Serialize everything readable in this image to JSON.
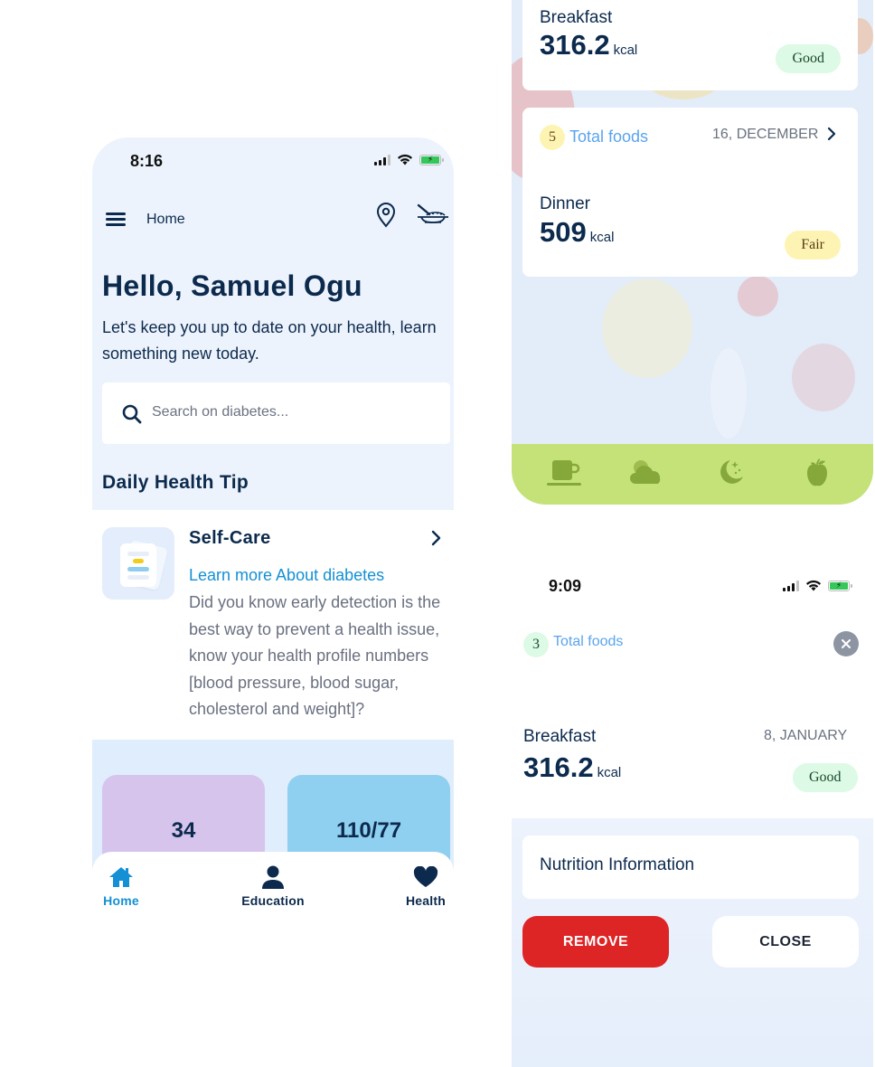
{
  "home_screen": {
    "status_bar": {
      "time": "8:16"
    },
    "topbar": {
      "title": "Home",
      "icons": [
        "menu-icon",
        "location-pin-icon",
        "food-bowl-icon"
      ]
    },
    "greeting": "Hello, Samuel Ogu",
    "subtitle": "Let's keep you up to date on your health, learn something new today.",
    "search": {
      "placeholder": "Search on diabetes...",
      "value": ""
    },
    "section_title": "Daily Health Tip",
    "tip": {
      "icon": "document-icon",
      "title": "Self-Care",
      "link": "Learn more About diabetes",
      "body": "Did you know early detection is the best way to prevent a health issue, know your health profile numbers [blood pressure, blood sugar, cholesterol and weight]?"
    },
    "metrics": [
      {
        "value": "34",
        "color": "#d7c4ec"
      },
      {
        "value": "110/77",
        "color": "#8fcfef"
      }
    ],
    "tabs": [
      {
        "label": "Home",
        "icon": "home-icon",
        "active": true
      },
      {
        "label": "Education",
        "icon": "person-icon",
        "active": false
      },
      {
        "label": "Health",
        "icon": "heart-icon",
        "active": false
      }
    ]
  },
  "meals_screen": {
    "cards": [
      {
        "meal": "Breakfast",
        "kcal": "316.2",
        "unit": "kcal",
        "rating": "Good"
      },
      {
        "count": "5",
        "count_label": "Total foods",
        "date": "16, DECEMBER",
        "meal": "Dinner",
        "kcal": "509",
        "unit": "kcal",
        "rating": "Fair"
      }
    ],
    "meal_bar_icons": [
      "coffee-cup-icon",
      "cloud-icon",
      "moon-stars-icon",
      "apple-icon"
    ]
  },
  "detail_screen": {
    "status_bar": {
      "time": "9:09"
    },
    "count": "3",
    "count_label": "Total foods",
    "meal": "Breakfast",
    "date": "8, JANUARY",
    "kcal": "316.2",
    "unit": "kcal",
    "rating": "Good",
    "nutrition_label": "Nutrition Information",
    "remove_label": "REMOVE",
    "close_label": "CLOSE"
  },
  "colors": {
    "navy": "#0c2a4d",
    "accent_blue": "#1590d4",
    "remove_red": "#de2526",
    "meal_bar_green": "#c4e278",
    "meal_icon_green": "#86a83a"
  }
}
